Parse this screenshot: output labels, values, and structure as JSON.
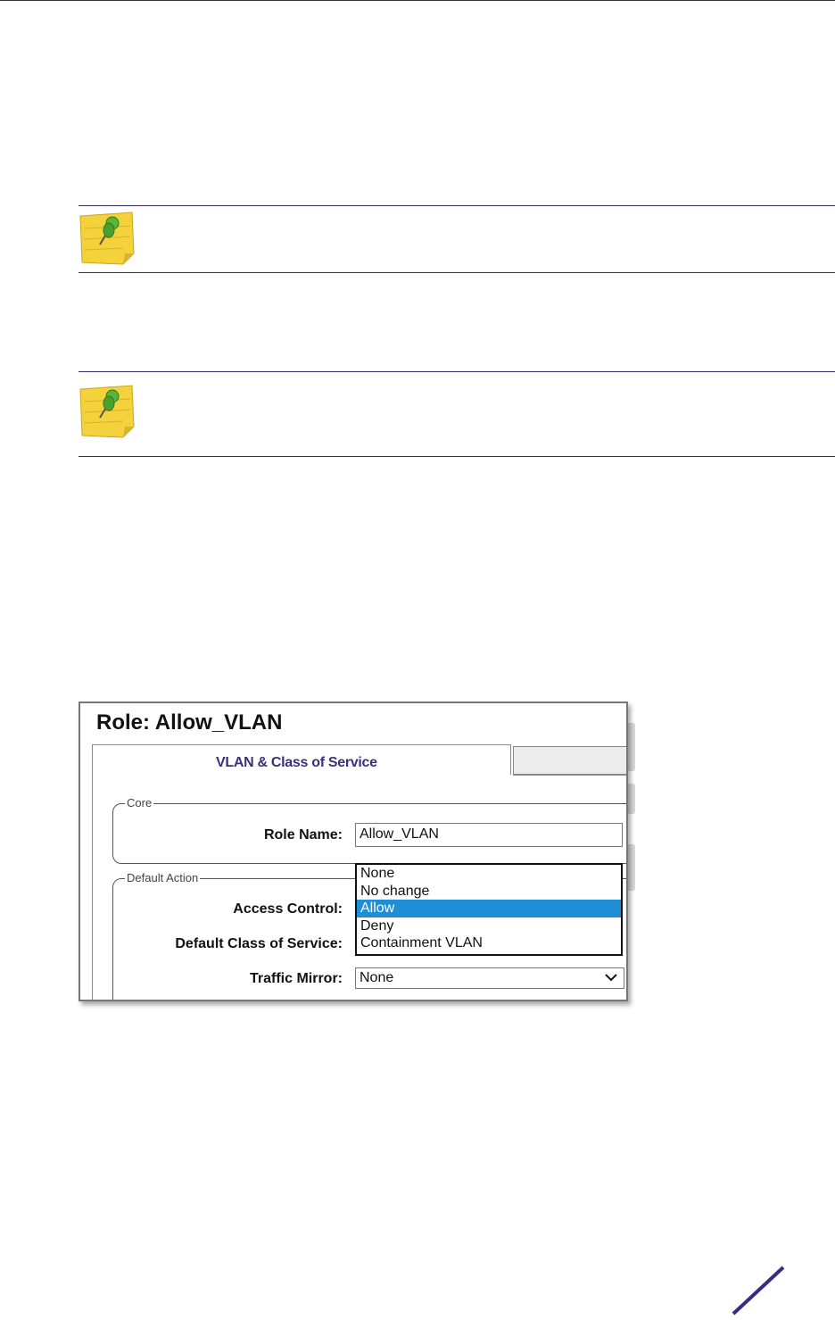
{
  "note_blocks": [
    {
      "icon": "sticky-note-pushpin-icon",
      "text": ""
    },
    {
      "icon": "sticky-note-pushpin-icon",
      "text": ""
    }
  ],
  "figure": {
    "title": "Role: Allow_VLAN",
    "active_tab": "VLAN & Class of Service",
    "core_section": {
      "legend": "Core",
      "role_name_label": "Role Name:",
      "role_name_value": "Allow_VLAN"
    },
    "default_action_section": {
      "legend": "Default Action",
      "access_control_label": "Access Control:",
      "access_control_options": [
        "None",
        "No change",
        "Allow",
        "Deny",
        "Containment VLAN"
      ],
      "access_control_selected": "Allow",
      "default_cos_label": "Default Class of Service:",
      "traffic_mirror_label": "Traffic Mirror:",
      "traffic_mirror_value": "None"
    }
  },
  "colors": {
    "rule": "#3a2a5e",
    "tab_label": "#3a3178",
    "selection": "#1e8fd6",
    "brand_slash": "#3b2a80"
  }
}
